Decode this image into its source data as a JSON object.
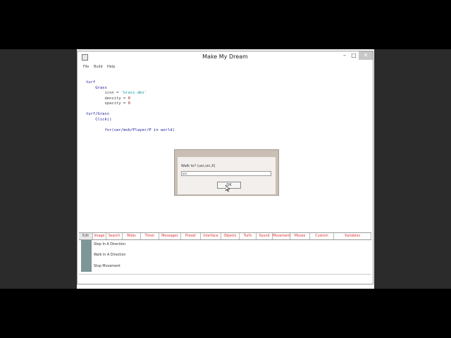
{
  "window": {
    "title": "Make My Dream"
  },
  "menu": [
    "File",
    "Build",
    "Help"
  ],
  "code_lines": [
    [
      {
        "t": "turf",
        "c": "kw"
      }
    ],
    [
      {
        "t": "    Grass",
        "c": "kw"
      }
    ],
    [
      {
        "t": "        icon = ",
        "c": "pl"
      },
      {
        "t": "'Grass.dmi'",
        "c": "str"
      }
    ],
    [
      {
        "t": "        density = ",
        "c": "pl"
      },
      {
        "t": "0",
        "c": "num"
      }
    ],
    [
      {
        "t": "        opacity = ",
        "c": "pl"
      },
      {
        "t": "0",
        "c": "num"
      }
    ],
    [],
    [
      {
        "t": "turf/Grass",
        "c": "kw"
      }
    ],
    [
      {
        "t": "    Click()",
        "c": "kw"
      }
    ],
    [],
    [
      {
        "t": "        for(var/mob/Player/P in world)",
        "c": "kw"
      }
    ]
  ],
  "tabs": [
    "Edit",
    "Image",
    "Search",
    "Mobs",
    "Timer",
    "Messages",
    "Preset",
    "Interface",
    "Objects",
    "Turfs",
    "Sound",
    "Movement",
    "Mouse",
    "Custom",
    "Variables"
  ],
  "actions": [
    "Step In A Direction",
    "Walk In A Direction",
    "Stop Movement"
  ],
  "dialog": {
    "prompt": "Walk to? (usr,src,X)",
    "input_value": "src",
    "ok_label": "OK"
  }
}
